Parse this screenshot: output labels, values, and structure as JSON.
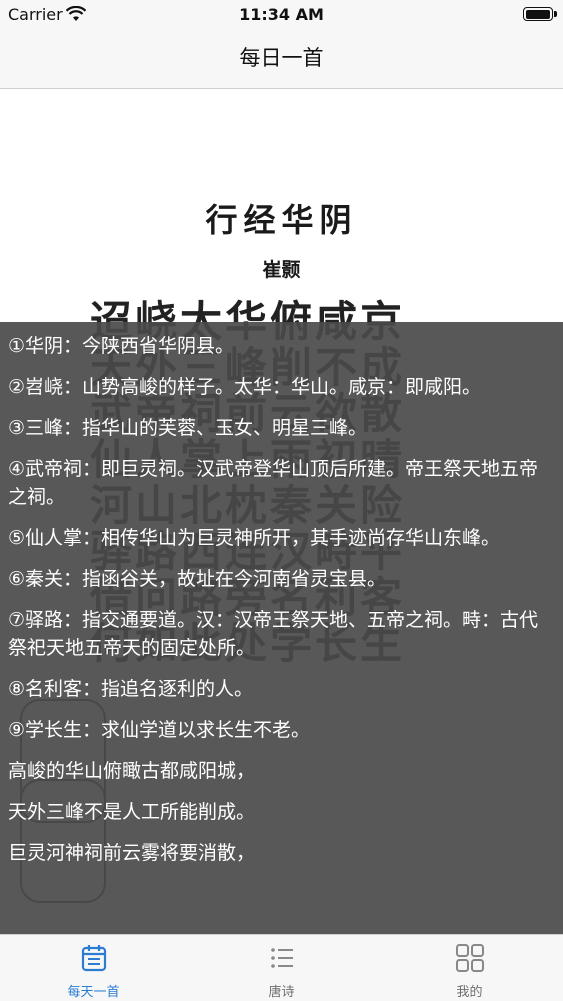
{
  "status_bar": {
    "carrier": "Carrier",
    "time": "11:34 AM",
    "battery_level": 1.0
  },
  "nav": {
    "title": "每日一首"
  },
  "poem": {
    "title": "行经华阴",
    "author": "崔颢",
    "calligraphy_lines": [
      "迢峣太华俯咸京",
      "天外三峰削不成",
      "武帝祠前云欲散",
      "仙人掌上雨初晴",
      "河山北枕秦关险",
      "驿路西连汉畤平",
      "借问路旁名利客",
      "何如此处学长生"
    ]
  },
  "notes": [
    "①华阴：今陕西省华阴县。",
    "②岧峣：山势高峻的样子。太华：华山。咸京：即咸阳。",
    "③三峰：指华山的芙蓉、玉女、明星三峰。",
    "④武帝祠：即巨灵祠。汉武帝登华山顶后所建。帝王祭天地五帝之祠。",
    "⑤仙人掌：相传华山为巨灵神所开，其手迹尚存华山东峰。",
    "⑥秦关：指函谷关，故址在今河南省灵宝县。",
    "⑦驿路：指交通要道。汉：汉帝王祭天地、五帝之祠。畤：古代祭祀天地五帝天的固定处所。",
    "⑧名利客：指追名逐利的人。",
    "⑨学长生：求仙学道以求长生不老。",
    "高峻的华山俯瞰古都咸阳城，",
    "天外三峰不是人工所能削成。",
    "巨灵河神祠前云雾将要消散，"
  ],
  "tabs": [
    {
      "label": "每天一首",
      "icon": "calendar-icon",
      "active": true
    },
    {
      "label": "唐诗",
      "icon": "list-icon",
      "active": false
    },
    {
      "label": "我的",
      "icon": "grid-icon",
      "active": false
    }
  ],
  "colors": {
    "accent": "#2b7cd3",
    "overlay": "#4a4a4a"
  }
}
